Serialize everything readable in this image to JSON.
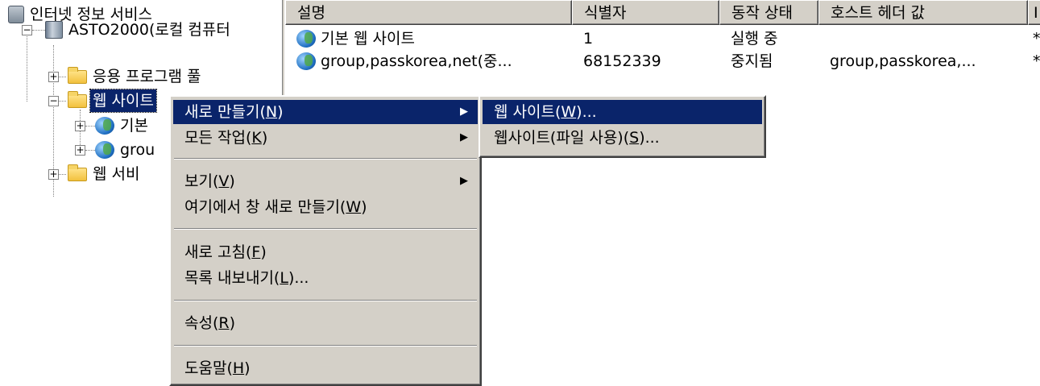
{
  "tree": {
    "root": "인터넷 정보 서비스",
    "computer": "ASTO2000(로컬 컴퓨터",
    "app_pools": "응용 프로그램 풀",
    "websites": "웹 사이트",
    "default_site": "기본",
    "group_site": "grou",
    "web_service": "웹 서비"
  },
  "list": {
    "columns": [
      "설명",
      "식별자",
      "동작 상태",
      "호스트 헤더 값",
      "I"
    ],
    "rows": [
      {
        "description": "기본 웹 사이트",
        "id": "1",
        "status": "실행 중",
        "host": "",
        "ip": "*"
      },
      {
        "description": "group,passkorea,net(중...",
        "id": "68152339",
        "status": "중지됨",
        "host": "group,passkorea,...",
        "ip": "*"
      }
    ]
  },
  "context_menu": {
    "new": {
      "text": "새로 만들기(",
      "key": "N",
      "end": ")"
    },
    "all_tasks": {
      "text": "모든 작업(",
      "key": "K",
      "end": ")"
    },
    "view": {
      "text": "보기(",
      "key": "V",
      "end": ")"
    },
    "new_window": {
      "text": "여기에서 창 새로 만들기(",
      "key": "W",
      "end": ")"
    },
    "refresh": {
      "text": "새로 고침(",
      "key": "F",
      "end": ")"
    },
    "export": {
      "text": "목록 내보내기(",
      "key": "L",
      "end": ")..."
    },
    "properties": {
      "text": "속성(",
      "key": "R",
      "end": ")"
    },
    "help": {
      "text": "도움말(",
      "key": "H",
      "end": ")"
    }
  },
  "submenu": {
    "website": {
      "text": "웹 사이트(",
      "key": "W",
      "end": ")..."
    },
    "website_from_file": {
      "text": "웹사이트(파일 사용)(",
      "key": "S",
      "end": ")..."
    }
  },
  "colors": {
    "highlight": "#0a246a",
    "menu_face": "#d4d0c8"
  }
}
